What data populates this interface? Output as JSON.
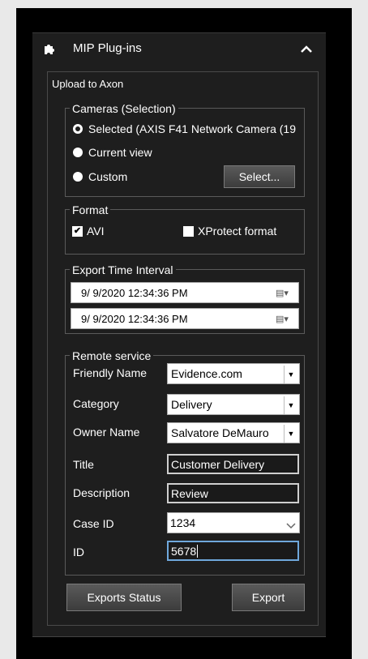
{
  "plugin_panel": {
    "title": "MIP Plug-ins",
    "collapse_icon": "chevron-up-icon",
    "header_icon": "puzzle-plugin-icon"
  },
  "upload": {
    "section_title": "Upload to Axon",
    "cameras": {
      "legend": "Cameras (Selection)",
      "selected_label": "Selected (AXIS F41 Network Camera (19",
      "current_view_label": "Current view",
      "custom_label": "Custom",
      "select_button": "Select..."
    },
    "format": {
      "legend": "Format",
      "avi_label": "AVI",
      "avi_checked": true,
      "xprotect_label": "XProtect format",
      "xprotect_checked": false
    },
    "export_time": {
      "legend": "Export Time Interval",
      "start": "9/  9/2020 12:34:36 PM",
      "end": "9/  9/2020 12:34:36 PM"
    },
    "remote": {
      "legend": "Remote service",
      "friendly_name_label": "Friendly Name",
      "friendly_name_value": "Evidence.com",
      "category_label": "Category",
      "category_value": "Delivery",
      "owner_label": "Owner Name",
      "owner_value": "Salvatore DeMauro",
      "title_label": "Title",
      "title_value": "Customer Delivery",
      "description_label": "Description",
      "description_value": "Review",
      "case_id_label": "Case ID",
      "case_id_value": "1234",
      "id_label": "ID",
      "id_value": "5678"
    },
    "buttons": {
      "exports_status": "Exports Status",
      "export": "Export"
    }
  }
}
